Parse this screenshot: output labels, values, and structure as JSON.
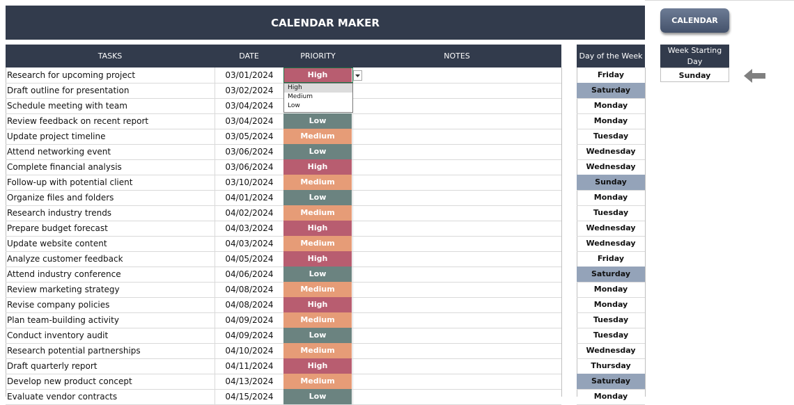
{
  "app": {
    "title": "CALENDAR MAKER",
    "calendar_button": "CALENDAR"
  },
  "columns": {
    "tasks": "TASKS",
    "date": "DATE",
    "priority": "PRIORITY",
    "notes": "NOTES"
  },
  "side": {
    "day_of_week_header": "Day of the Week",
    "week_starting_header": "Week Starting Day",
    "week_starting_value": "Sunday"
  },
  "priority_options": [
    "High",
    "Medium",
    "Low"
  ],
  "colors": {
    "header": "#323b4c",
    "High": "#b85d70",
    "Medium": "#e69c77",
    "Low": "#6b8380",
    "weekend": "#94a3b9"
  },
  "rows": [
    {
      "task": "Research for upcoming project",
      "date": "03/01/2024",
      "priority": "High",
      "day": "Friday",
      "weekend": false
    },
    {
      "task": "Draft outline for presentation",
      "date": "03/02/2024",
      "priority": "",
      "day": "Saturday",
      "weekend": true
    },
    {
      "task": "Schedule meeting with team",
      "date": "03/04/2024",
      "priority": "",
      "day": "Monday",
      "weekend": false
    },
    {
      "task": "Review feedback on recent report",
      "date": "03/04/2024",
      "priority": "Low",
      "day": "Monday",
      "weekend": false
    },
    {
      "task": "Update project timeline",
      "date": "03/05/2024",
      "priority": "Medium",
      "day": "Tuesday",
      "weekend": false
    },
    {
      "task": "Attend networking event",
      "date": "03/06/2024",
      "priority": "Low",
      "day": "Wednesday",
      "weekend": false
    },
    {
      "task": "Complete financial analysis",
      "date": "03/06/2024",
      "priority": "High",
      "day": "Wednesday",
      "weekend": false
    },
    {
      "task": "Follow-up with potential client",
      "date": "03/10/2024",
      "priority": "Medium",
      "day": "Sunday",
      "weekend": true
    },
    {
      "task": " Organize files and folders",
      "date": "04/01/2024",
      "priority": "Low",
      "day": "Monday",
      "weekend": false
    },
    {
      "task": "Research industry trends",
      "date": "04/02/2024",
      "priority": "Medium",
      "day": "Tuesday",
      "weekend": false
    },
    {
      "task": "Prepare budget forecast",
      "date": "04/03/2024",
      "priority": "High",
      "day": "Wednesday",
      "weekend": false
    },
    {
      "task": "Update website content",
      "date": "04/03/2024",
      "priority": "Medium",
      "day": "Wednesday",
      "weekend": false
    },
    {
      "task": "Analyze customer feedback",
      "date": "04/05/2024",
      "priority": "High",
      "day": "Friday",
      "weekend": false
    },
    {
      "task": "Attend industry conference",
      "date": "04/06/2024",
      "priority": "Low",
      "day": "Saturday",
      "weekend": true
    },
    {
      "task": "Review marketing strategy",
      "date": "04/08/2024",
      "priority": "Medium",
      "day": "Monday",
      "weekend": false
    },
    {
      "task": "Revise company policies",
      "date": "04/08/2024",
      "priority": "High",
      "day": "Monday",
      "weekend": false
    },
    {
      "task": "Plan team-building activity",
      "date": "04/09/2024",
      "priority": "Medium",
      "day": "Tuesday",
      "weekend": false
    },
    {
      "task": "Conduct inventory audit",
      "date": "04/09/2024",
      "priority": "Low",
      "day": "Tuesday",
      "weekend": false
    },
    {
      "task": " Research potential partnerships",
      "date": "04/10/2024",
      "priority": "Medium",
      "day": "Wednesday",
      "weekend": false
    },
    {
      "task": "Draft quarterly report",
      "date": "04/11/2024",
      "priority": "High",
      "day": "Thursday",
      "weekend": false
    },
    {
      "task": "Develop new product concept",
      "date": "04/13/2024",
      "priority": "Medium",
      "day": "Saturday",
      "weekend": true
    },
    {
      "task": "Evaluate vendor contracts",
      "date": "04/15/2024",
      "priority": "Low",
      "day": "Monday",
      "weekend": false
    }
  ]
}
